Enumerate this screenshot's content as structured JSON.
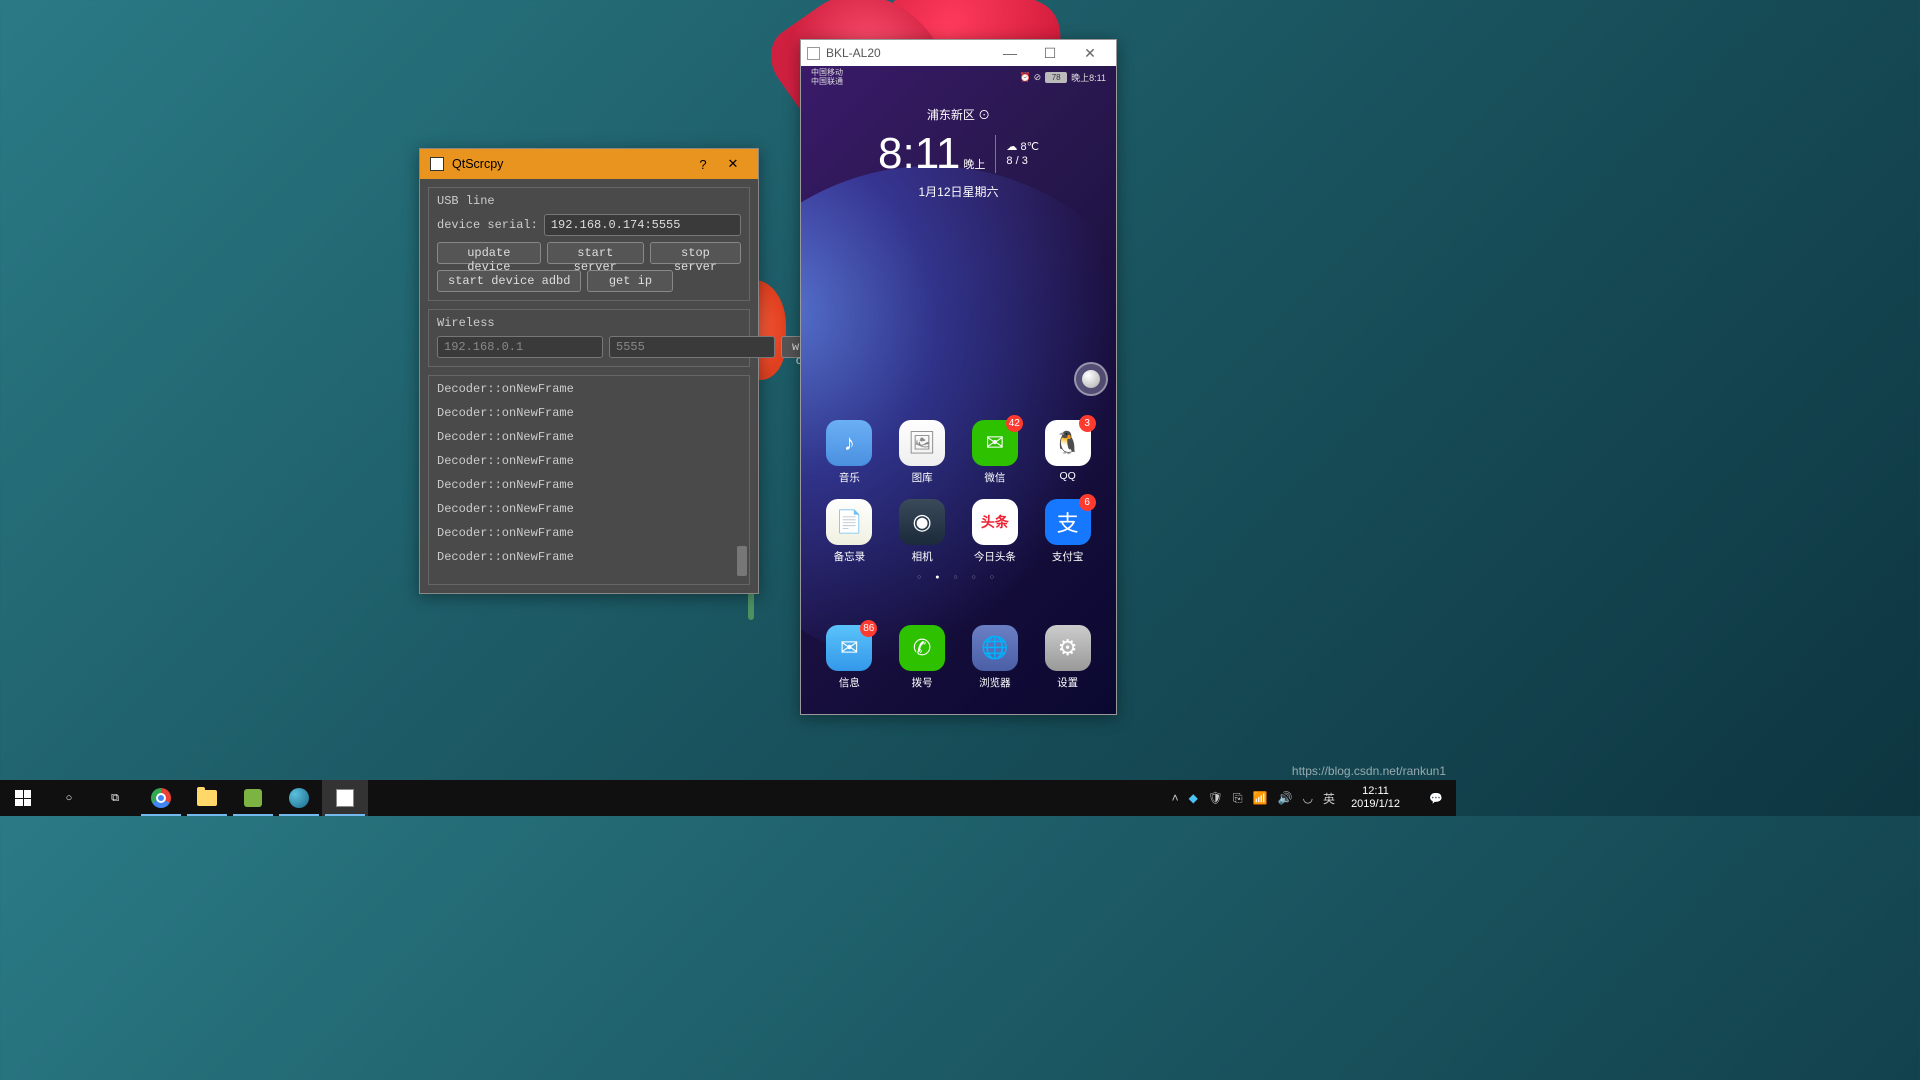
{
  "qt": {
    "title": "QtScrcpy",
    "usb_group": "USB line",
    "device_serial_label": "device serial:",
    "device_serial_value": "192.168.0.174:5555",
    "update_device": "update device",
    "start_server": "start server",
    "stop_server": "stop server",
    "start_adbd": "start device adbd",
    "get_ip": "get ip",
    "wireless_group": "Wireless",
    "ip_placeholder": "192.168.0.1",
    "port_placeholder": "5555",
    "wireless_connect": "wireless connect",
    "log_lines": [
      "Decoder::onNewFrame",
      "Decoder::onNewFrame",
      "Decoder::onNewFrame",
      "Decoder::onNewFrame",
      "Decoder::onNewFrame",
      "Decoder::onNewFrame",
      "Decoder::onNewFrame",
      "Decoder::onNewFrame"
    ]
  },
  "phone": {
    "win_title": "BKL-AL20",
    "carrier": "中国移动\n中国联通",
    "signal_extra": "4G ⁴ᴳ 📶 🔔 ⏰ ⊘",
    "battery": "78",
    "status_time": "晚上8:11",
    "location": "浦东新区 ⊙",
    "time": "8:11",
    "ampm": "晚上",
    "temp": "8℃",
    "weather_range": "8 / 3",
    "date": "1月12日星期六",
    "apps_row1": [
      {
        "label": "音乐",
        "color": "ic-music",
        "glyph": "♪",
        "badge": ""
      },
      {
        "label": "图库",
        "color": "ic-gallery",
        "glyph": "🖼",
        "badge": ""
      },
      {
        "label": "微信",
        "color": "ic-wechat",
        "glyph": "✉",
        "badge": "42"
      },
      {
        "label": "QQ",
        "color": "ic-qq",
        "glyph": "🐧",
        "badge": "3"
      }
    ],
    "apps_row2": [
      {
        "label": "备忘录",
        "color": "ic-memo",
        "glyph": "📄",
        "badge": ""
      },
      {
        "label": "相机",
        "color": "ic-camera",
        "glyph": "◉",
        "badge": ""
      },
      {
        "label": "今日头条",
        "color": "ic-toutiao",
        "glyph": "头条",
        "badge": ""
      },
      {
        "label": "支付宝",
        "color": "ic-alipay",
        "glyph": "支",
        "badge": "6"
      }
    ],
    "dock": [
      {
        "label": "信息",
        "color": "ic-msg",
        "glyph": "✉",
        "badge": "86"
      },
      {
        "label": "拨号",
        "color": "ic-dial",
        "glyph": "✆",
        "badge": ""
      },
      {
        "label": "浏览器",
        "color": "ic-browser",
        "glyph": "🌐",
        "badge": ""
      },
      {
        "label": "设置",
        "color": "ic-settings",
        "glyph": "⚙",
        "badge": ""
      }
    ]
  },
  "taskbar": {
    "ime": "英",
    "time": "12:11",
    "date": "2019/1/12"
  },
  "watermark": "https://blog.csdn.net/rankun1"
}
